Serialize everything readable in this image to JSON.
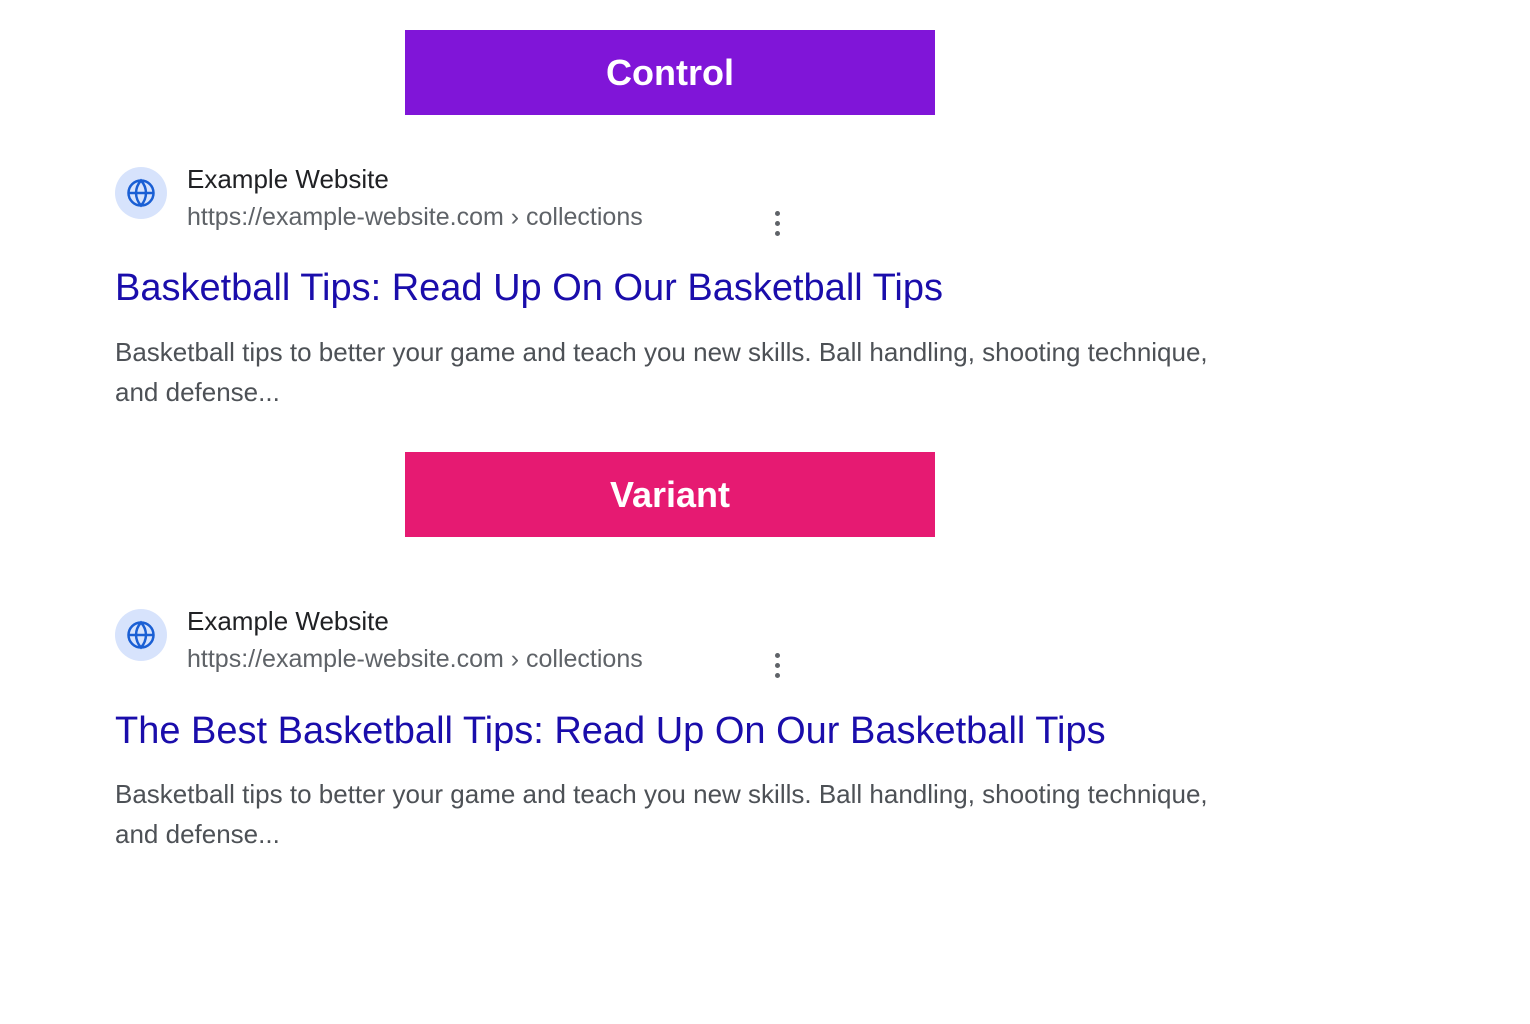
{
  "labels": {
    "control": "Control",
    "variant": "Variant"
  },
  "control": {
    "site_name": "Example Website",
    "breadcrumb": "https://example-website.com › collections",
    "title": "Basketball Tips: Read Up On Our Basketball Tips",
    "description": "Basketball tips to better your game and teach you new skills. Ball handling, shooting technique, and defense..."
  },
  "variant": {
    "site_name": "Example Website",
    "breadcrumb": "https://example-website.com › collections",
    "title": "The Best Basketball Tips: Read Up On Our Basketball Tips",
    "description": "Basketball tips to better your game and teach you new skills. Ball handling, shooting technique, and defense..."
  },
  "colors": {
    "control_bg": "#8015d8",
    "variant_bg": "#e61a72",
    "link_blue": "#1a0dab"
  }
}
